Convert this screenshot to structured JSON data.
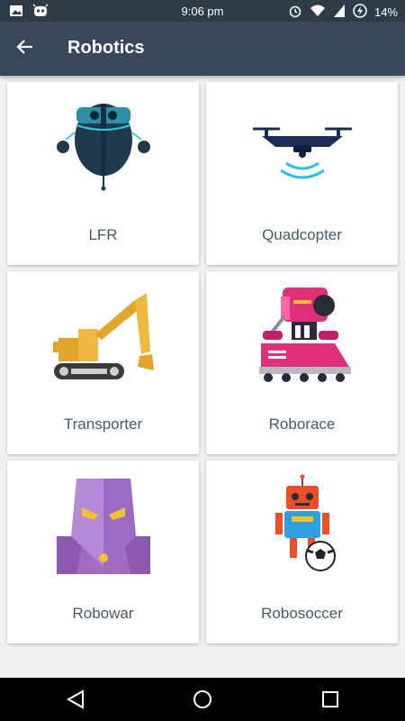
{
  "status": {
    "time": "9:06 pm",
    "battery": "14%",
    "left_icons": [
      "image-icon",
      "cyanogen-icon"
    ],
    "right_icons": [
      "alarm-icon",
      "wifi-icon",
      "signal-icon",
      "battery-icon"
    ]
  },
  "app_bar": {
    "title": "Robotics",
    "back_icon": "arrow-left-icon"
  },
  "cards": [
    {
      "label": "LFR",
      "icon": "lfr-robot-icon"
    },
    {
      "label": "Quadcopter",
      "icon": "quadcopter-icon"
    },
    {
      "label": "Transporter",
      "icon": "excavator-icon"
    },
    {
      "label": "Roborace",
      "icon": "roborace-robot-icon"
    },
    {
      "label": "Robowar",
      "icon": "robowar-robot-icon"
    },
    {
      "label": "Robosoccer",
      "icon": "robosoccer-robot-icon"
    }
  ],
  "nav": {
    "icons": [
      "back-triangle-icon",
      "home-circle-icon",
      "recents-square-icon"
    ]
  },
  "colors": {
    "app_bar": "#37485a",
    "status_bar": "#2e3c48",
    "card_label": "#455a6a",
    "background": "#f0f0f0"
  }
}
